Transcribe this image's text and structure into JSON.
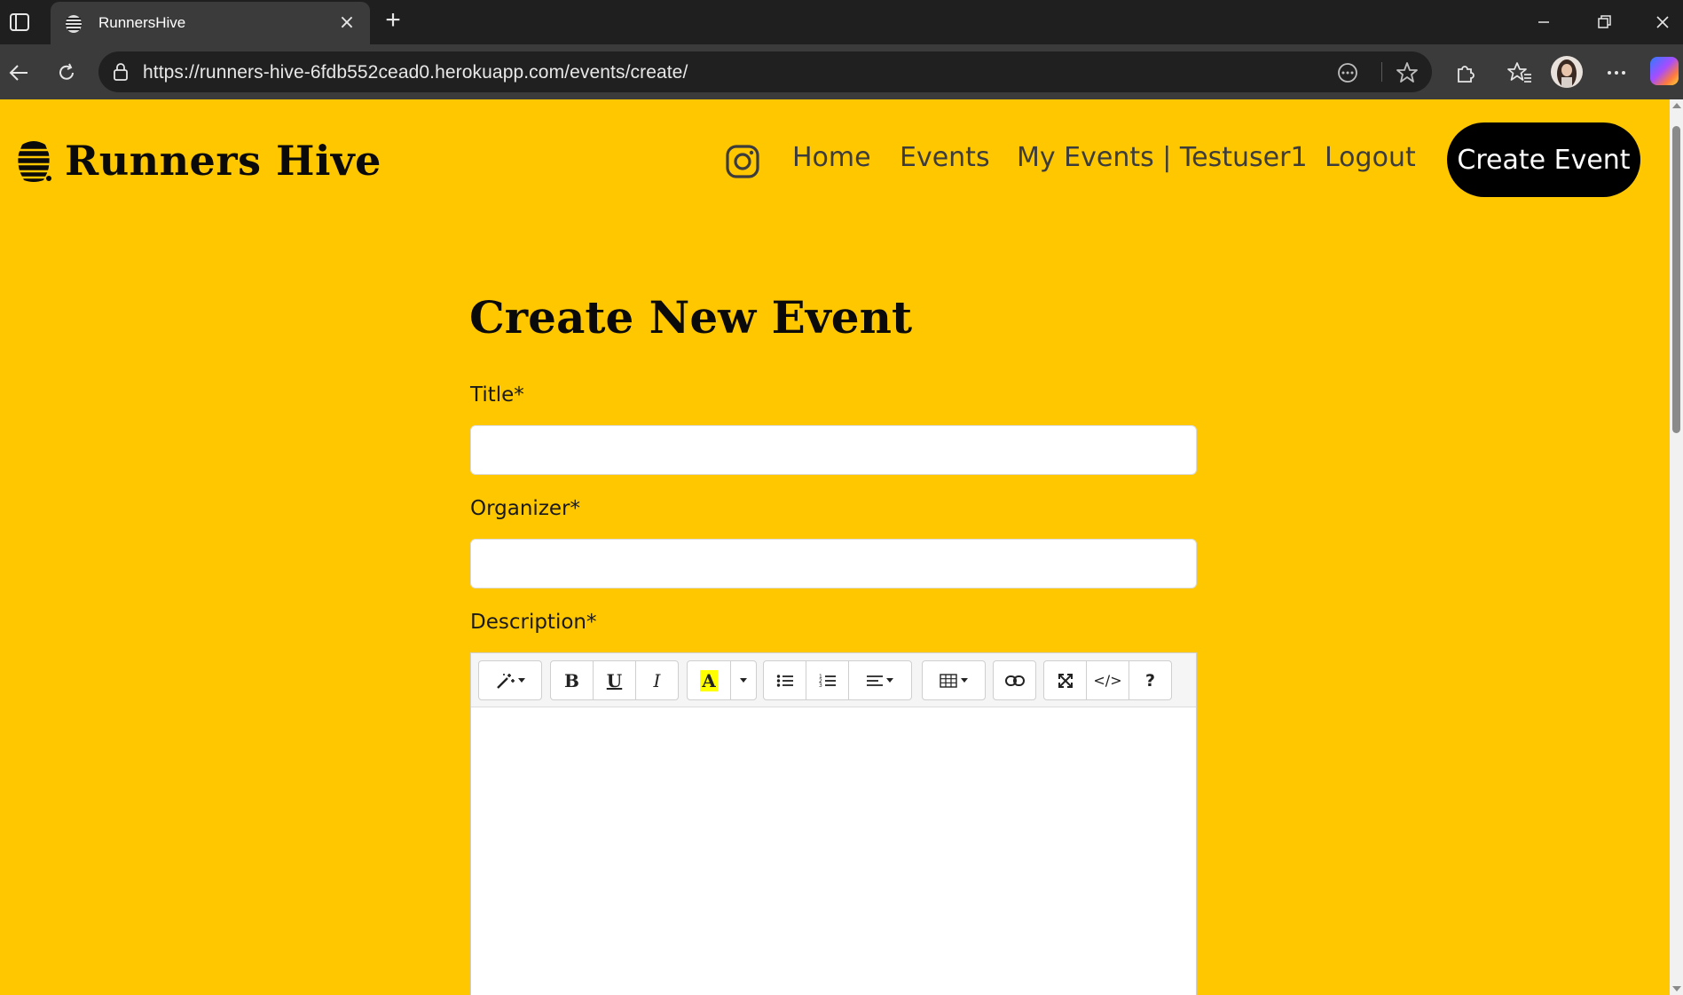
{
  "browser": {
    "tab_title": "RunnersHive",
    "new_tab_symbol": "+",
    "tab_close_symbol": "×",
    "url": "https://runners-hive-6fdb552cead0.herokuapp.com/events/create/"
  },
  "site": {
    "brand": "Runners Hive",
    "nav": {
      "home": "Home",
      "events": "Events",
      "my_events": "My Events | Testuser1",
      "logout": "Logout",
      "create_event": "Create Event"
    }
  },
  "form": {
    "heading": "Create New Event",
    "title_label": "Title*",
    "title_value": "",
    "organizer_label": "Organizer*",
    "organizer_value": "",
    "description_label": "Description*",
    "toolbar": {
      "bold": "B",
      "underline": "U",
      "italic": "I",
      "color": "A",
      "code": "</>",
      "help": "?"
    }
  },
  "colors": {
    "page_background": "#ffc700",
    "button_background": "#000000",
    "nav_text": "#3c3c3c"
  }
}
